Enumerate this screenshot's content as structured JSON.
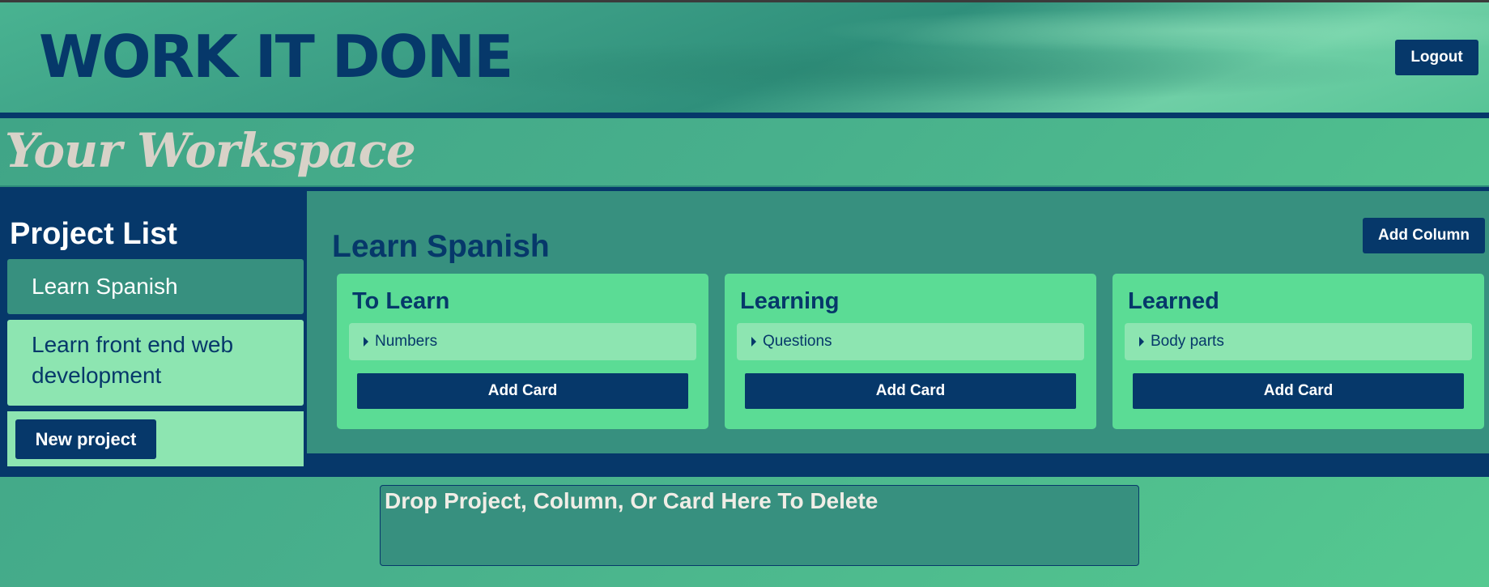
{
  "app": {
    "logo": "WORK IT DONE",
    "logout_label": "Logout"
  },
  "page": {
    "title": "Your Workspace"
  },
  "sidebar": {
    "title": "Project List",
    "projects": [
      {
        "label": "Learn Spanish",
        "active": true
      },
      {
        "label": "Learn front end web development",
        "active": false
      }
    ],
    "new_project_label": "New project"
  },
  "board": {
    "title": "Learn Spanish",
    "add_column_label": "Add Column",
    "columns": [
      {
        "title": "To Learn",
        "cards": [
          "Numbers"
        ],
        "add_card_label": "Add Card"
      },
      {
        "title": "Learning",
        "cards": [
          "Questions"
        ],
        "add_card_label": "Add Card"
      },
      {
        "title": "Learned",
        "cards": [
          "Body parts"
        ],
        "add_card_label": "Add Card"
      }
    ]
  },
  "dropzone": {
    "label": "Drop Project, Column, Or Card Here To Delete"
  },
  "colors": {
    "primary": "#06386a",
    "column_bg": "#5bdc95",
    "card_bg": "#8de5b1",
    "board_bg": "#37907f",
    "workspace_title": "#d8d2c8"
  }
}
